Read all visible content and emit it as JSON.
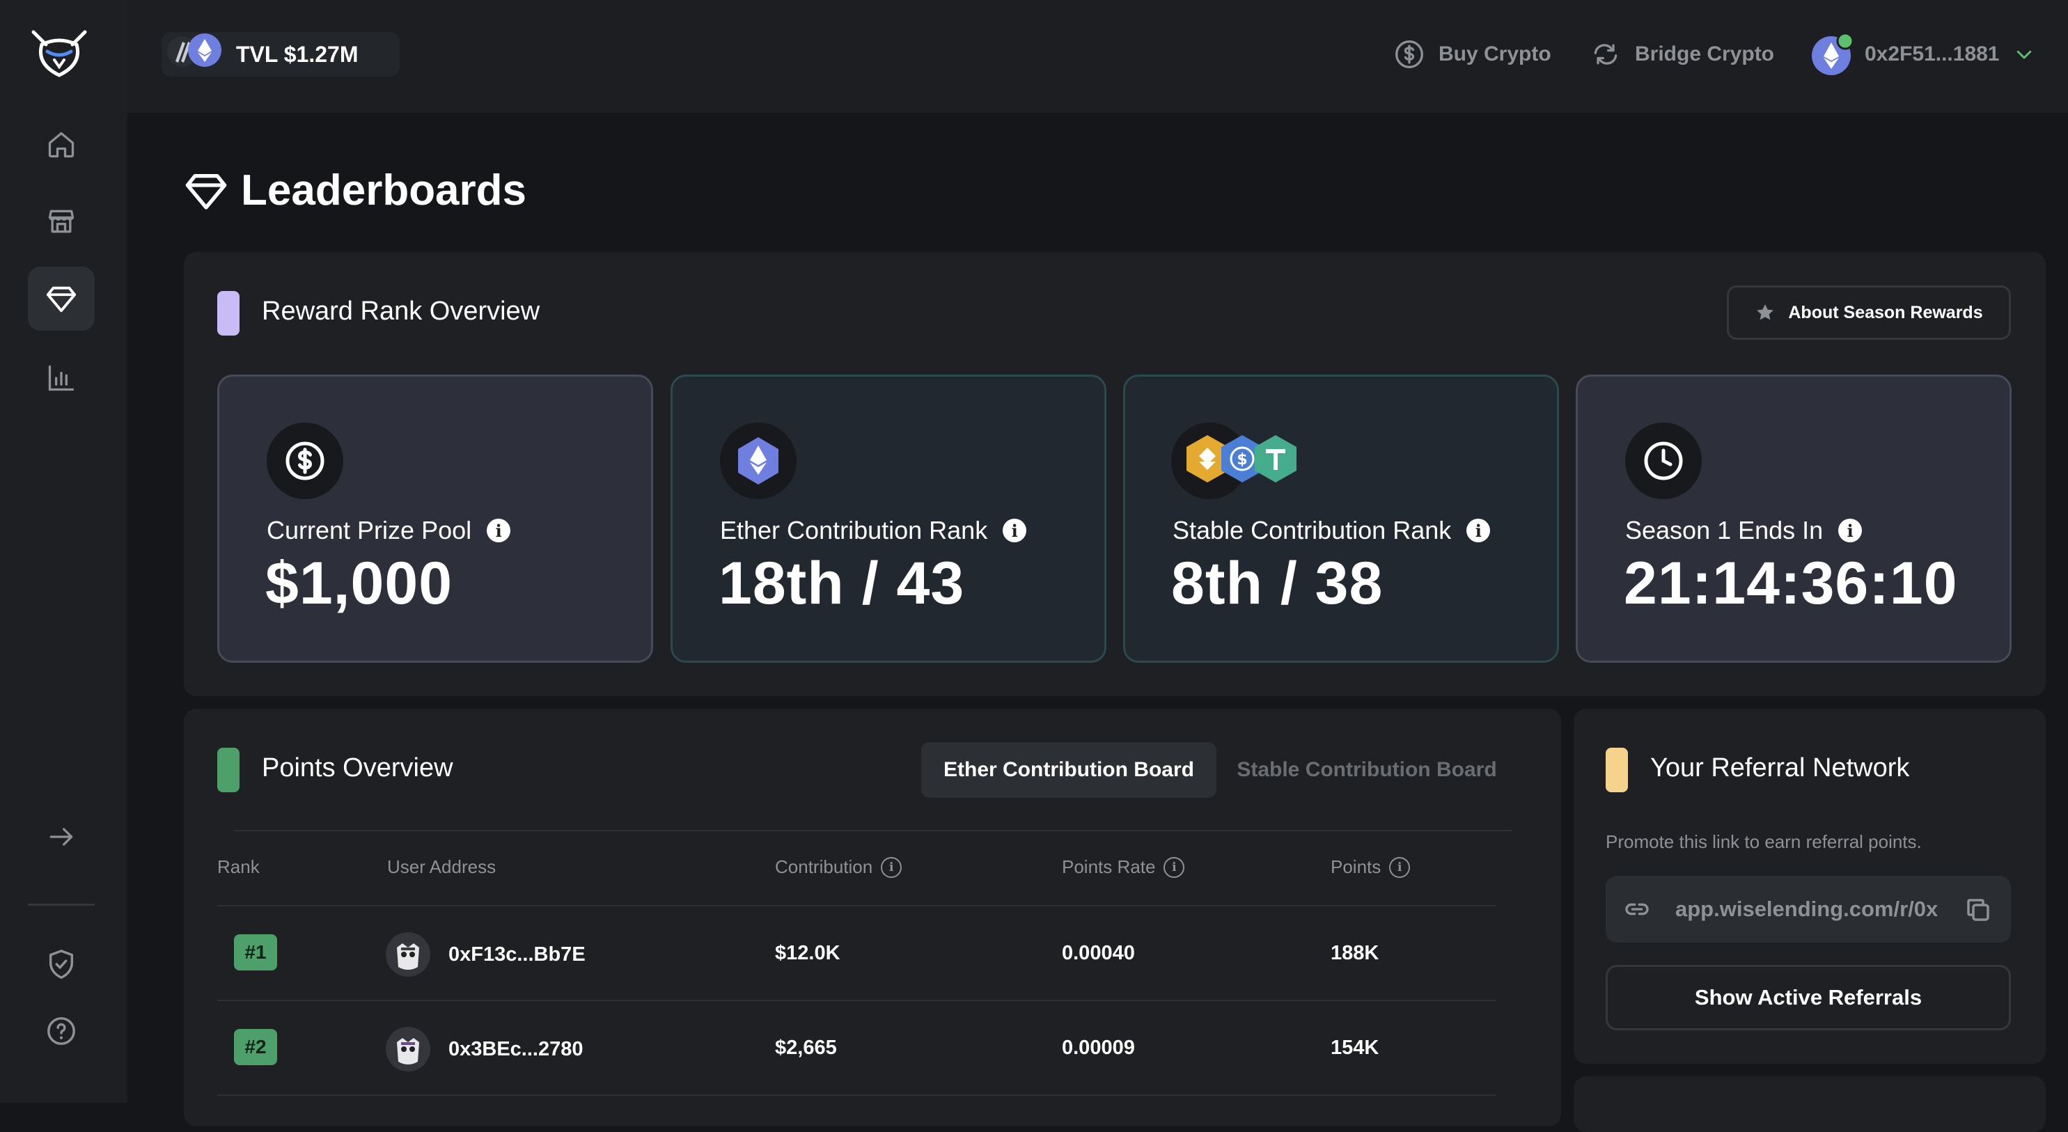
{
  "topbar": {
    "tvl_label": "TVL $1.27M",
    "buy_crypto": "Buy Crypto",
    "bridge_crypto": "Bridge Crypto",
    "wallet_address": "0x2F51...1881"
  },
  "page": {
    "title": "Leaderboards"
  },
  "reward_overview": {
    "title": "Reward Rank Overview",
    "about_button": "About Season Rewards",
    "cards": [
      {
        "label": "Current Prize Pool",
        "value": "$1,000",
        "icon": "dollar-icon"
      },
      {
        "label": "Ether Contribution Rank",
        "value": "18th / 43",
        "icon": "ethereum-icon"
      },
      {
        "label": "Stable Contribution Rank",
        "value": "8th / 38",
        "icon": "stablecoins-icon"
      },
      {
        "label": "Season 1 Ends In",
        "value": "21:14:36:10",
        "icon": "clock-icon"
      }
    ]
  },
  "points_overview": {
    "title": "Points Overview",
    "tabs": [
      "Ether Contribution Board",
      "Stable Contribution Board"
    ],
    "active_tab": "Ether Contribution Board",
    "columns": [
      "Rank",
      "User Address",
      "Contribution",
      "Points Rate",
      "Points"
    ],
    "rows": [
      {
        "rank": "#1",
        "address": "0xF13c...Bb7E",
        "contribution": "$12.0K",
        "points_rate": "0.00040",
        "points": "188K"
      },
      {
        "rank": "#2",
        "address": "0x3BEc...2780",
        "contribution": "$2,665",
        "points_rate": "0.00009",
        "points": "154K"
      }
    ]
  },
  "referral": {
    "title": "Your Referral Network",
    "description": "Promote this link to earn referral points.",
    "link": "app.wiselending.com/r/0x",
    "show_button": "Show Active Referrals"
  },
  "colors": {
    "background": "#141619",
    "panel": "#1e2024",
    "accent_purple": "#c9bcf6",
    "accent_green": "#4da06a",
    "accent_yellow": "#f6d38c",
    "eth_blue": "#6f7fe0"
  }
}
